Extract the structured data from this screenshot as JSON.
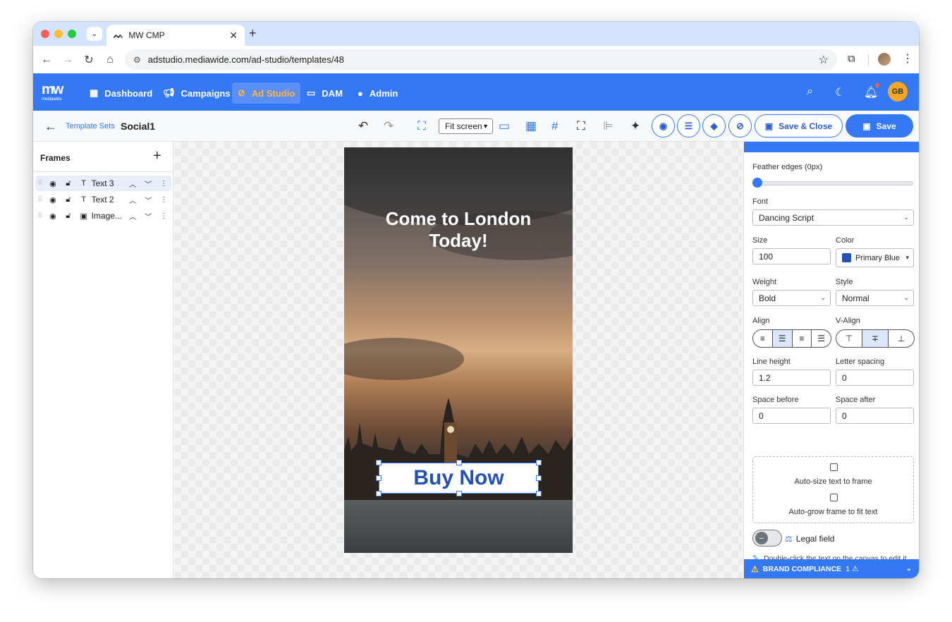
{
  "browser": {
    "tab_title": "MW CMP",
    "url": "adstudio.mediawide.com/ad-studio/templates/48"
  },
  "nav": {
    "logo": "mw",
    "logo_sub": "mediawide",
    "items": [
      {
        "label": "Dashboard",
        "icon": "dashboard-icon"
      },
      {
        "label": "Campaigns",
        "icon": "megaphone-icon"
      },
      {
        "label": "Ad Studio",
        "icon": "palette-icon",
        "active": true
      },
      {
        "label": "DAM",
        "icon": "folder-icon"
      },
      {
        "label": "Admin",
        "icon": "admin-icon"
      }
    ],
    "avatar": "GB"
  },
  "toolbar": {
    "breadcrumb": "Template Sets",
    "template_name": "Social1",
    "zoom": "Fit screen",
    "save_close": "Save & Close",
    "save": "Save"
  },
  "frames": {
    "title": "Frames",
    "items": [
      {
        "name": "Text 3",
        "type": "text",
        "selected": true
      },
      {
        "name": "Text 2",
        "type": "text"
      },
      {
        "name": "Image...",
        "type": "image"
      }
    ]
  },
  "canvas": {
    "headline": "Come to London Today!",
    "cta": "Buy Now"
  },
  "props": {
    "feather_label": "Feather edges (0px)",
    "feather_value": 0,
    "font_label": "Font",
    "font_value": "Dancing Script",
    "size_label": "Size",
    "size_value": "100",
    "color_label": "Color",
    "color_value": "Primary Blue",
    "color_hex": "#2451b3",
    "weight_label": "Weight",
    "weight_value": "Bold",
    "style_label": "Style",
    "style_value": "Normal",
    "align_label": "Align",
    "valign_label": "V-Align",
    "line_height_label": "Line height",
    "line_height_value": "1.2",
    "letter_spacing_label": "Letter spacing",
    "letter_spacing_value": "0",
    "space_before_label": "Space before",
    "space_before_value": "0",
    "space_after_label": "Space after",
    "space_after_value": "0",
    "autosize_label": "Auto-size text to frame",
    "autogrow_label": "Auto-grow frame to fit text",
    "legal_label": "Legal field",
    "hint": "Double-click the text on the canvas to edit it. Use the styling controls here to change its look.",
    "compliance_label": "BRAND COMPLIANCE",
    "compliance_count": "1 ⚠"
  },
  "colors": {
    "brand_blue": "#3478f6",
    "active_nav_text": "#ffb347"
  }
}
